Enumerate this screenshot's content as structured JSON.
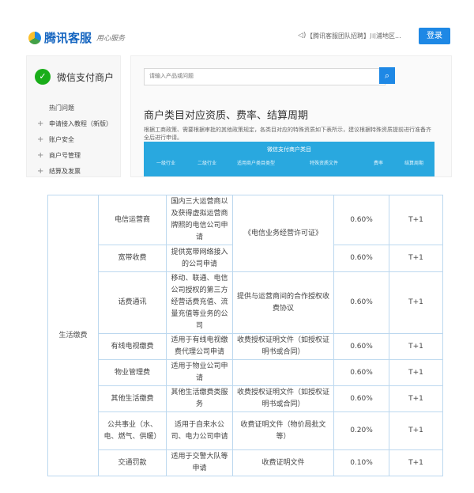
{
  "header": {
    "logo_text": "腾讯客服",
    "logo_subtitle": "用心服务",
    "notice": "【腾讯客服团队招聘】川浦地区...",
    "login_label": "登录"
  },
  "sidebar": {
    "brand": "微信支付商户",
    "items": [
      {
        "label": "热门问题",
        "expandable": false
      },
      {
        "label": "申请接入教程（新版）",
        "expandable": true
      },
      {
        "label": "账户安全",
        "expandable": true
      },
      {
        "label": "商户号管理",
        "expandable": true
      },
      {
        "label": "结算及发票",
        "expandable": true
      }
    ]
  },
  "search": {
    "placeholder": "请输入产品或问题"
  },
  "article": {
    "title": "商户类目对应资质、费率、结算周期",
    "description": "根据工商政策、需要根据审批的其他政策规定，各类目对应的特殊资质如下表所示，建议根据特殊资质提前进行准备齐全后进行申请。"
  },
  "mini_table": {
    "caption": "微信支付商户类目",
    "headers": [
      "一级行业",
      "二级行业",
      "适用商户类目类型",
      "特殊资质文件",
      "费率",
      "结算周期"
    ]
  },
  "fee_table": {
    "category": "生活缴费",
    "rows": [
      {
        "name": "电信运营商",
        "applies": "国内三大运营商以及获得虚拟运营商牌照的电信公司申请",
        "docs": "《电信业务经营许可证》",
        "rate": "0.60%",
        "cycle": "T+1"
      },
      {
        "name": "宽带收费",
        "applies": "提供宽带网络接入的公司申请",
        "docs": "",
        "rate": "0.60%",
        "cycle": "T+1"
      },
      {
        "name": "话费通讯",
        "applies": "移动、联通、电信公司授权的第三方经营话费充值、流量充值等业务的公司",
        "docs": "提供与运营商间的合作授权收费协议",
        "rate": "0.60%",
        "cycle": "T+1"
      },
      {
        "name": "有线电视缴费",
        "applies": "适用于有线电视缴费代理公司申请",
        "docs": "收费授权证明文件（如授权证明书或合同）",
        "rate": "0.60%",
        "cycle": "T+1"
      },
      {
        "name": "物业管理费",
        "applies": "适用于物业公司申请",
        "docs": "",
        "rate": "0.60%",
        "cycle": "T+1"
      },
      {
        "name": "其他生活缴费",
        "applies": "其他生活缴费类服务",
        "docs": "收费授权证明文件（如授权证明书或合同）",
        "rate": "0.60%",
        "cycle": "T+1"
      },
      {
        "name": "公共事业（水、电、燃气、供暖）",
        "applies": "适用于自来水公司、电力公司申请",
        "docs": "收费证明文件（物价局批文等）",
        "rate": "0.20%",
        "cycle": "T+1"
      },
      {
        "name": "交通罚款",
        "applies": "适用于交警大队等申请",
        "docs": "收费证明文件",
        "rate": "0.10%",
        "cycle": "T+1"
      }
    ]
  }
}
